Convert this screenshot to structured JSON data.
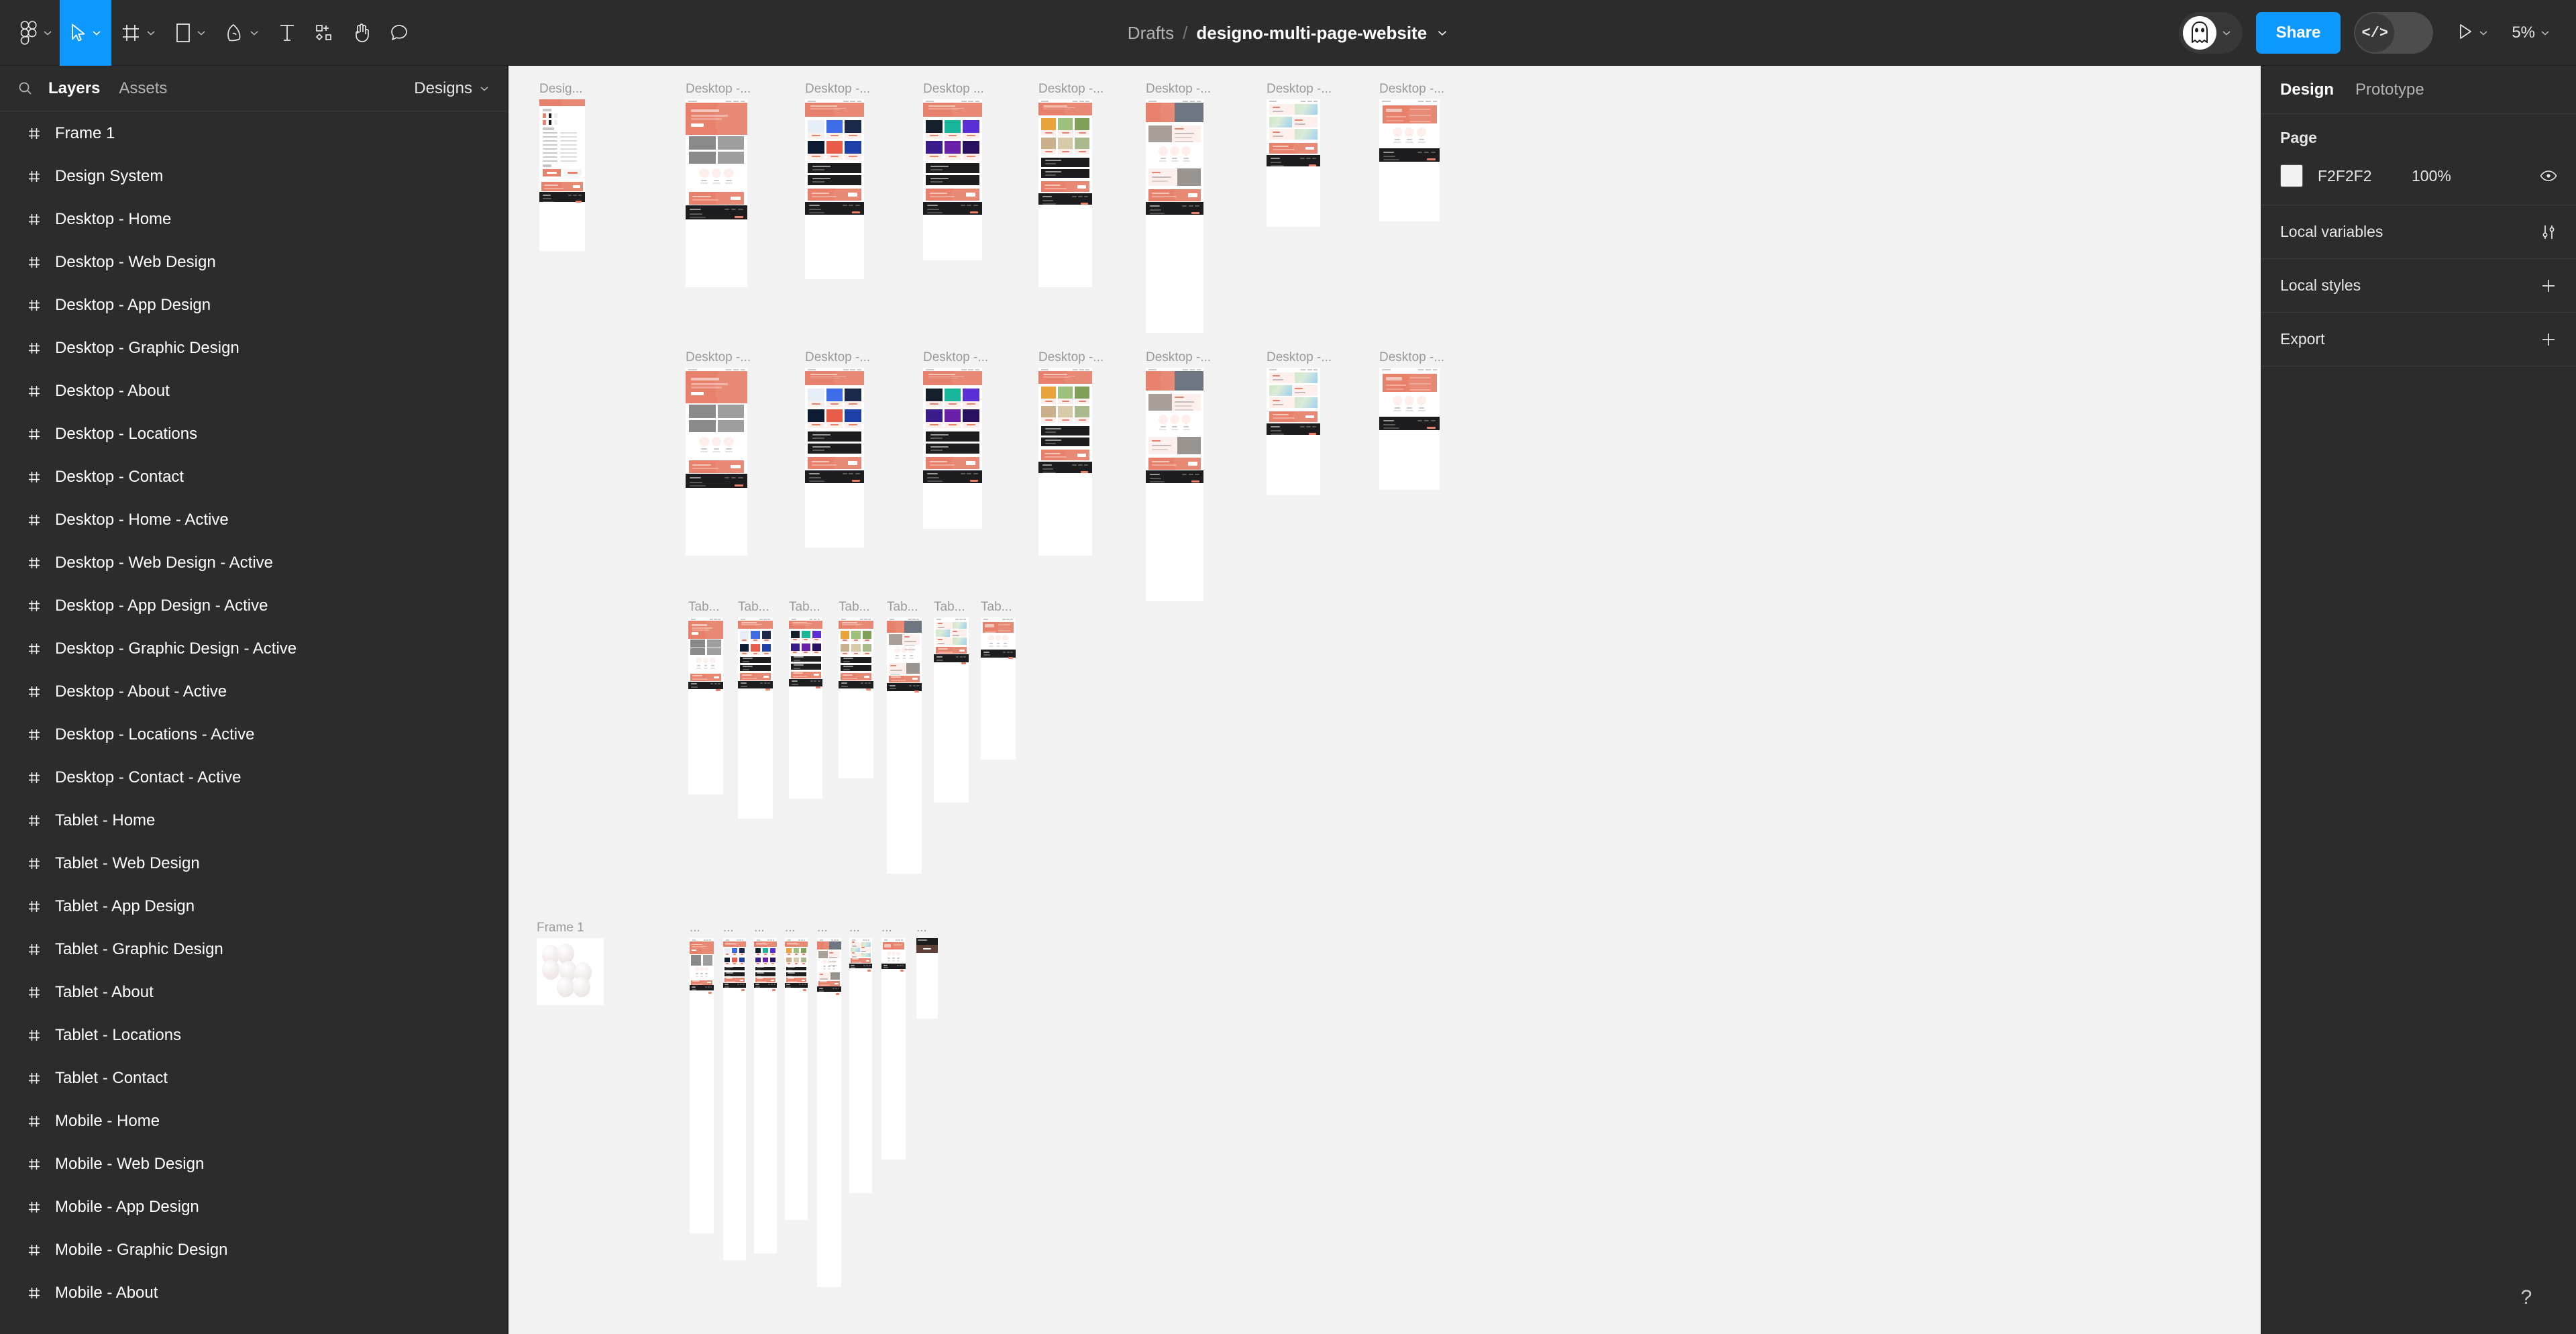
{
  "toolbar": {
    "logo_icon": "figma-logo-icon",
    "tools": [
      {
        "name": "figma-menu",
        "icon": "figma-logo-icon",
        "chevron": true,
        "active": false
      },
      {
        "name": "move-tool",
        "icon": "cursor-arrow-icon",
        "chevron": true,
        "active": true
      },
      {
        "name": "frame-tool",
        "icon": "frame-grid-icon",
        "chevron": true,
        "active": false
      },
      {
        "name": "shape-tool",
        "icon": "rectangle-icon",
        "chevron": true,
        "active": false
      },
      {
        "name": "pen-tool",
        "icon": "pen-nib-icon",
        "chevron": true,
        "active": false
      },
      {
        "name": "text-tool",
        "icon": "text-t-icon",
        "chevron": false,
        "active": false
      },
      {
        "name": "resources-tool",
        "icon": "components-plus-icon",
        "chevron": false,
        "active": false
      },
      {
        "name": "hand-tool",
        "icon": "hand-icon",
        "chevron": false,
        "active": false
      },
      {
        "name": "comment-tool",
        "icon": "comment-bubble-icon",
        "chevron": false,
        "active": false
      }
    ],
    "breadcrumb_project": "Drafts",
    "breadcrumb_separator": "/",
    "file_name": "designo-multi-page-website",
    "file_chevron_icon": "chevron-down-icon",
    "avatar_icon": "ghost-avatar-icon",
    "avatar_chevron_icon": "chevron-down-icon",
    "share_label": "Share",
    "devmode_icon": "code-brackets-icon",
    "present_icon": "play-triangle-icon",
    "present_chevron_icon": "chevron-down-icon",
    "zoom_level": "5%",
    "zoom_chevron_icon": "chevron-down-icon"
  },
  "left_panel": {
    "search_icon": "search-icon",
    "tabs": [
      {
        "label": "Layers",
        "selected": true
      },
      {
        "label": "Assets",
        "selected": false
      }
    ],
    "designs_label": "Designs",
    "designs_chevron_icon": "chevron-down-icon",
    "layer_icon": "frame-hash-icon",
    "layers": [
      "Frame 1",
      "Design System",
      "Desktop - Home",
      "Desktop - Web Design",
      "Desktop - App Design",
      "Desktop - Graphic Design",
      "Desktop - About",
      "Desktop - Locations",
      "Desktop - Contact",
      "Desktop - Home - Active",
      "Desktop - Web Design - Active",
      "Desktop - App Design - Active",
      "Desktop - Graphic Design - Active",
      "Desktop - About - Active",
      "Desktop - Locations - Active",
      "Desktop - Contact - Active",
      "Tablet - Home",
      "Tablet - Web Design",
      "Tablet - App Design",
      "Tablet - Graphic Design",
      "Tablet - About",
      "Tablet - Locations",
      "Tablet - Contact",
      "Mobile - Home",
      "Mobile - Web Design",
      "Mobile - App Design",
      "Mobile - Graphic Design",
      "Mobile - About"
    ]
  },
  "right_panel": {
    "tabs": [
      {
        "label": "Design",
        "selected": true
      },
      {
        "label": "Prototype",
        "selected": false
      }
    ],
    "page": {
      "title": "Page",
      "fill_hex": "F2F2F2",
      "fill_color": "#F2F2F2",
      "opacity": "100%",
      "visibility_icon": "eye-icon"
    },
    "local_variables": {
      "label": "Local variables",
      "action_icon": "sliders-icon"
    },
    "local_styles": {
      "label": "Local styles",
      "action_icon": "plus-icon"
    },
    "export": {
      "label": "Export",
      "action_icon": "plus-icon"
    }
  },
  "canvas": {
    "background_color": "#F2F2F2",
    "accent_coral": "#E7816B",
    "accent_pink": "#FDF0EC",
    "accent_dark": "#1D1C1E",
    "rows": [
      {
        "name": "desktop-row-1",
        "frames": [
          {
            "label": "Desig...",
            "kind": "designsystem"
          },
          {
            "label": "Desktop -...",
            "kind": "home"
          },
          {
            "label": "Desktop -...",
            "kind": "webdesign"
          },
          {
            "label": "Desktop ...",
            "kind": "appdesign"
          },
          {
            "label": "Desktop -...",
            "kind": "graphic"
          },
          {
            "label": "Desktop -...",
            "kind": "about"
          },
          {
            "label": "Desktop -...",
            "kind": "locations"
          },
          {
            "label": "Desktop -...",
            "kind": "contact"
          }
        ]
      },
      {
        "name": "desktop-row-2",
        "frames": [
          {
            "label": "Desktop -...",
            "kind": "home"
          },
          {
            "label": "Desktop -...",
            "kind": "webdesign"
          },
          {
            "label": "Desktop -...",
            "kind": "appdesign"
          },
          {
            "label": "Desktop -...",
            "kind": "graphic"
          },
          {
            "label": "Desktop -...",
            "kind": "about"
          },
          {
            "label": "Desktop -...",
            "kind": "locations"
          },
          {
            "label": "Desktop -...",
            "kind": "contact"
          }
        ]
      },
      {
        "name": "tablet-row",
        "frames": [
          {
            "label": "Tab...",
            "kind": "home"
          },
          {
            "label": "Tab...",
            "kind": "webdesign"
          },
          {
            "label": "Tab...",
            "kind": "appdesign"
          },
          {
            "label": "Tab...",
            "kind": "graphic"
          },
          {
            "label": "Tab...",
            "kind": "about"
          },
          {
            "label": "Tab...",
            "kind": "locations"
          },
          {
            "label": "Tab...",
            "kind": "contact"
          }
        ]
      },
      {
        "name": "mobile-row",
        "frames": [
          {
            "label": "Frame 1",
            "kind": "frame1"
          },
          {
            "label": "...",
            "kind": "home"
          },
          {
            "label": "...",
            "kind": "webdesign"
          },
          {
            "label": "...",
            "kind": "appdesign"
          },
          {
            "label": "...",
            "kind": "graphic"
          },
          {
            "label": "...",
            "kind": "about"
          },
          {
            "label": "...",
            "kind": "locations"
          },
          {
            "label": "...",
            "kind": "contact"
          },
          {
            "label": "...",
            "kind": "contactdark"
          }
        ]
      }
    ]
  },
  "help": {
    "label": "?",
    "icon": "question-mark-icon"
  }
}
